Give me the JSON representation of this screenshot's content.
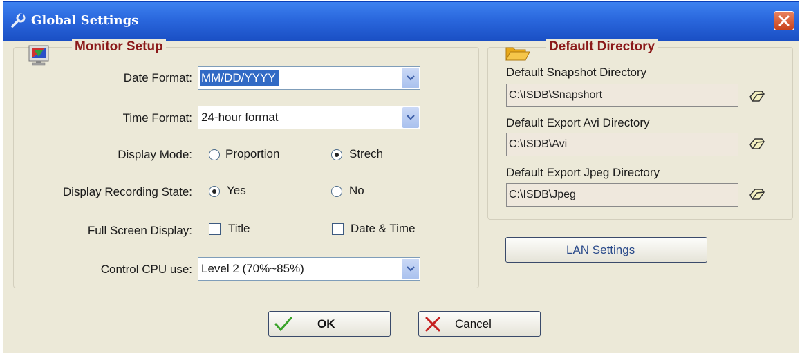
{
  "window": {
    "title": "Global Settings"
  },
  "monitor": {
    "title": "Monitor Setup",
    "date_format": {
      "label": "Date Format:",
      "value": "MM/DD/YYYY"
    },
    "time_format": {
      "label": "Time Format:",
      "value": "24-hour format"
    },
    "display_mode": {
      "label": "Display Mode:",
      "opt1": "Proportion",
      "opt2": "Strech",
      "selected": "Strech"
    },
    "recording_state": {
      "label": "Display Recording State:",
      "opt1": "Yes",
      "opt2": "No",
      "selected": "Yes"
    },
    "full_screen": {
      "label": "Full Screen Display:",
      "opt1": "Title",
      "opt2": "Date & Time",
      "opt1_checked": false,
      "opt2_checked": false
    },
    "cpu": {
      "label": "Control CPU use:",
      "value": "Level 2 (70%~85%)"
    }
  },
  "directory": {
    "title": "Default Directory",
    "snapshot": {
      "label": "Default Snapshot Directory",
      "value": "C:\\ISDB\\Snapshort"
    },
    "avi": {
      "label": "Default Export Avi Directory",
      "value": "C:\\ISDB\\Avi"
    },
    "jpeg": {
      "label": "Default Export Jpeg Directory",
      "value": "C:\\ISDB\\Jpeg"
    }
  },
  "buttons": {
    "lan": "LAN Settings",
    "ok": "OK",
    "cancel": "Cancel"
  },
  "icons": {
    "title": "wrench-icon",
    "close": "close-icon",
    "monitor": "monitor-icon",
    "folder": "folder-icon",
    "browse": "browse-folder-icon",
    "ok": "checkmark-icon",
    "cancel": "x-icon",
    "dropdown": "chevron-down-icon"
  },
  "colors": {
    "titlebar": "#2a67dd",
    "group_title": "#8b1a1a",
    "selection": "#316ac5",
    "ok_check": "#3aa32a",
    "cancel_x": "#c62020"
  }
}
